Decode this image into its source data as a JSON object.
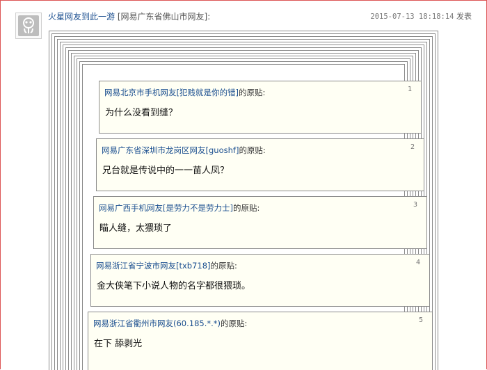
{
  "header": {
    "username": "火星网友到此一游",
    "location": "[网易广东省佛山市网友]:",
    "timestamp": "2015-07-13 18:18:14",
    "action": "发表"
  },
  "posts": [
    {
      "author": "网易北京市手机网友",
      "nick": "[犯贱就是你的错]",
      "suffix": "的原贴:",
      "number": "1",
      "text": "为什么没看到缝？"
    },
    {
      "author": "网易广东省深圳市龙岗区网友",
      "nick": "[guoshf]",
      "suffix": "的原贴:",
      "number": "2",
      "text": "兄台就是传说中的一一苗人凤？"
    },
    {
      "author": "网易广西手机网友",
      "nick": "[是劳力不是劳力士]",
      "suffix": "的原贴:",
      "number": "3",
      "text": "瞄人缝，太猥琐了"
    },
    {
      "author": "网易浙江省宁波市网友",
      "nick": "[txb718]",
      "suffix": "的原贴:",
      "number": "4",
      "text": "金大侠笔下小说人物的名字都很猥琐。"
    },
    {
      "author": "网易浙江省衢州市网友",
      "nick": "(60.185.*.*)",
      "suffix": "的原贴:",
      "number": "5",
      "text": "在下  舔剥光"
    }
  ],
  "colors": {
    "link": "#1a4e8f",
    "border": "#8a8a8a",
    "quote_bg": "#fffff4",
    "outer_border": "#dd5555"
  }
}
